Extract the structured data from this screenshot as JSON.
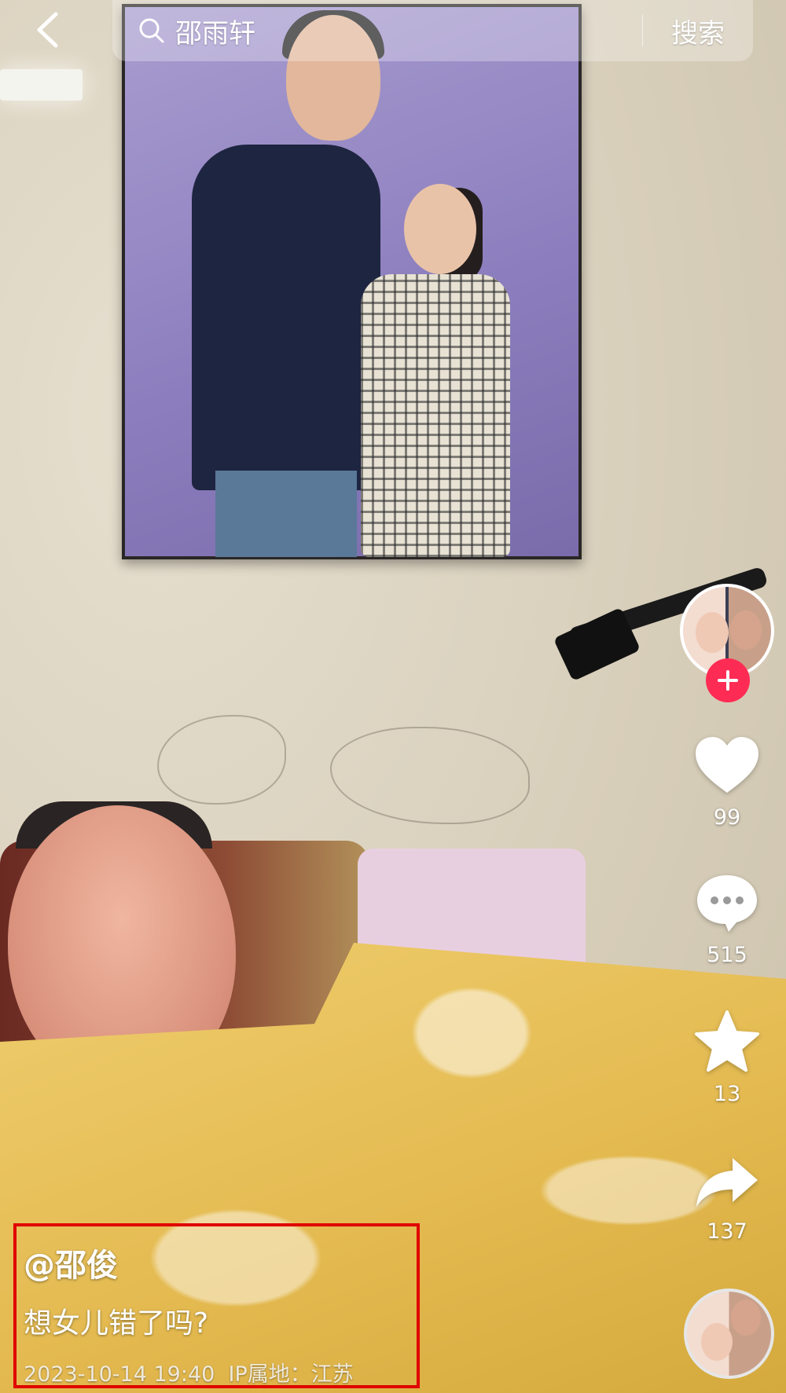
{
  "search": {
    "query": "邵雨轩",
    "button_label": "搜索"
  },
  "actions": {
    "likes": "99",
    "comments": "515",
    "favorites": "13",
    "shares": "137"
  },
  "caption": {
    "author": "@邵俊",
    "text": "想女儿错了吗?",
    "date": "2023-10-14 19:40",
    "ip_label": "IP属地：江苏"
  },
  "colors": {
    "follow": "#fe2c55",
    "highlight_box": "#e00000"
  },
  "icons": {
    "back": "chevron-left-icon",
    "search": "search-icon",
    "follow": "plus-icon",
    "like": "heart-icon",
    "comment": "comment-bubble-icon",
    "favorite": "star-icon",
    "share": "share-arrow-icon"
  }
}
